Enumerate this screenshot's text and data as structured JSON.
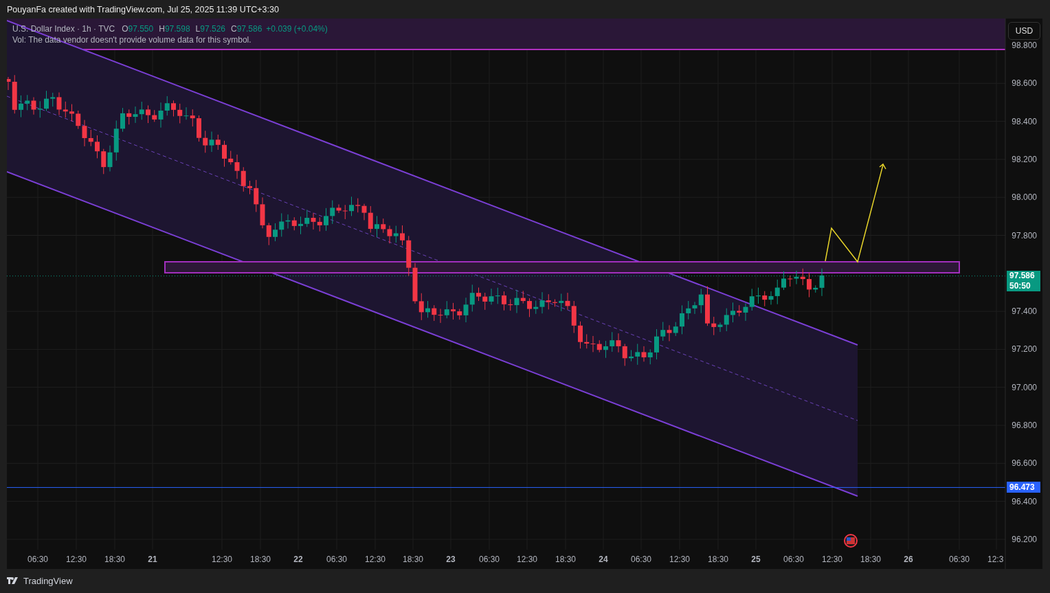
{
  "header": {
    "text": "PouyanFa created with TradingView.com, Jul 25, 2025 11:39 UTC+3:30"
  },
  "legend": {
    "symbol": "U.S. Dollar Index · 1h · TVC",
    "ohlc": [
      {
        "label": "O",
        "value": "97.550"
      },
      {
        "label": "H",
        "value": "97.598"
      },
      {
        "label": "L",
        "value": "97.526"
      },
      {
        "label": "C",
        "value": "97.586"
      }
    ],
    "change": "+0.039 (+0.04%)",
    "volume_note": "Vol: The data vendor doesn't provide volume data for this symbol."
  },
  "currency_button": "USD",
  "price_ticks": [
    "98.800",
    "98.600",
    "98.400",
    "98.200",
    "98.000",
    "97.800",
    "97.400",
    "97.200",
    "97.000",
    "96.800",
    "96.600",
    "96.400",
    "96.200"
  ],
  "price_labels": [
    {
      "kind": "last",
      "value": "97.586",
      "countdown": "50:50",
      "color": "#089981"
    },
    {
      "kind": "line",
      "value": "96.473",
      "color": "#2962ff"
    }
  ],
  "time_ticks": [
    {
      "label": "06:30",
      "kind": "time"
    },
    {
      "label": "12:30",
      "kind": "time"
    },
    {
      "label": "18:30",
      "kind": "time"
    },
    {
      "label": "21",
      "kind": "day"
    },
    {
      "label": "12:30",
      "kind": "time"
    },
    {
      "label": "18:30",
      "kind": "time"
    },
    {
      "label": "22",
      "kind": "day"
    },
    {
      "label": "06:30",
      "kind": "time"
    },
    {
      "label": "12:30",
      "kind": "time"
    },
    {
      "label": "18:30",
      "kind": "time"
    },
    {
      "label": "23",
      "kind": "day"
    },
    {
      "label": "06:30",
      "kind": "time"
    },
    {
      "label": "12:30",
      "kind": "time"
    },
    {
      "label": "18:30",
      "kind": "time"
    },
    {
      "label": "24",
      "kind": "day"
    },
    {
      "label": "06:30",
      "kind": "time"
    },
    {
      "label": "12:30",
      "kind": "time"
    },
    {
      "label": "18:30",
      "kind": "time"
    },
    {
      "label": "25",
      "kind": "day"
    },
    {
      "label": "06:30",
      "kind": "time"
    },
    {
      "label": "12:30",
      "kind": "time"
    },
    {
      "label": "18:30",
      "kind": "time"
    },
    {
      "label": "26",
      "kind": "day"
    },
    {
      "label": "06:30",
      "kind": "time"
    },
    {
      "label": "12:3",
      "kind": "time"
    }
  ],
  "footer": {
    "logo_text": "TradingView"
  }
}
